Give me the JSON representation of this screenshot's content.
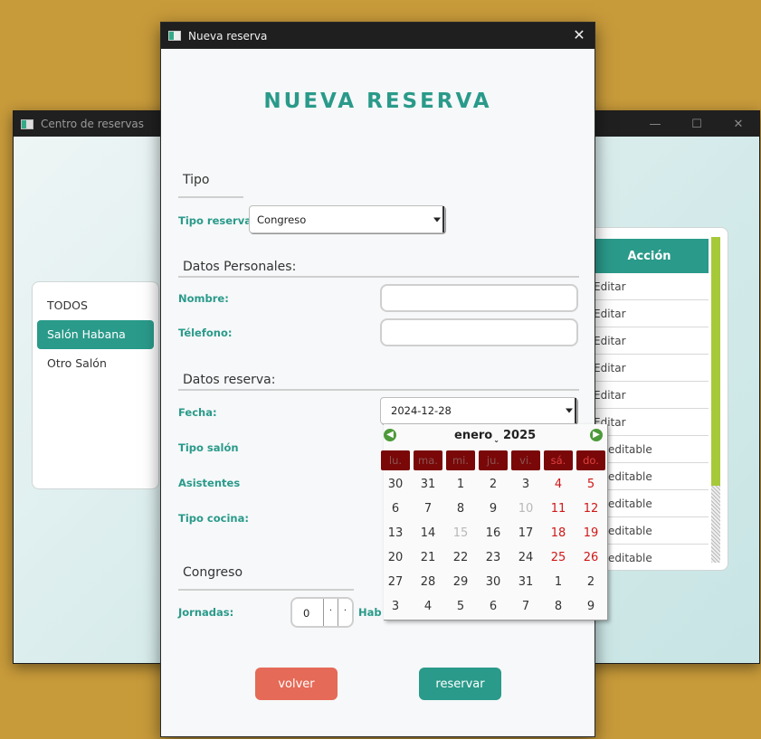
{
  "background_window": {
    "title": "Centro de reservas",
    "controls": {
      "minimize": "—",
      "maximize": "☐",
      "close": "✕"
    },
    "salon_list": [
      "TODOS",
      "Salón Habana",
      "Otro Salón"
    ],
    "selected_salon": "Salón Habana",
    "table": {
      "column_header": "Acción",
      "rows": [
        "Editar",
        "Editar",
        "Editar",
        "Editar",
        "Editar",
        "Editar",
        "editable",
        "editable",
        "editable",
        "editable",
        "editable"
      ]
    }
  },
  "dialog": {
    "title": "Nueva reserva",
    "close_glyph": "✕",
    "heading": "NUEVA RESERVA",
    "sections": {
      "tipo": "Tipo",
      "datos_personales": "Datos Personales:",
      "datos_reserva": "Datos reserva:",
      "congreso": "Congreso"
    },
    "labels": {
      "tipo_reserva": "Tipo reserva:",
      "nombre": "Nombre:",
      "telefono": "Télefono:",
      "fecha": "Fecha:",
      "tipo_salon": "Tipo salón",
      "asistentes": "Asistentes",
      "tipo_cocina": "Tipo cocina:",
      "jornadas": "Jornadas:",
      "hab": "Hab"
    },
    "values": {
      "tipo_reserva": "Congreso",
      "nombre": "",
      "telefono": "",
      "fecha": "2024-12-28",
      "jornadas": "0",
      "spinner_dec": "·",
      "spinner_inc": "·"
    },
    "buttons": {
      "volver": "volver",
      "reservar": "reservar"
    }
  },
  "calendar": {
    "month": "enero",
    "year": "2025",
    "prev_glyph": "◀",
    "next_glyph": "▶",
    "weekdays": [
      "lu.",
      "ma.",
      "mi.",
      "ju.",
      "vi.",
      "sá.",
      "do."
    ],
    "weeks": [
      [
        "30",
        "31",
        "1",
        "2",
        "3",
        "4",
        "5"
      ],
      [
        "6",
        "7",
        "8",
        "9",
        "10",
        "11",
        "12"
      ],
      [
        "13",
        "14",
        "15",
        "16",
        "17",
        "18",
        "19"
      ],
      [
        "20",
        "21",
        "22",
        "23",
        "24",
        "25",
        "26"
      ],
      [
        "27",
        "28",
        "29",
        "30",
        "31",
        "1",
        "2"
      ],
      [
        "3",
        "4",
        "5",
        "6",
        "7",
        "8",
        "9"
      ]
    ],
    "dimmed_days": [
      "15",
      "10"
    ],
    "colors": {
      "weekend": "#d01818",
      "header_bg": "#7a0808",
      "accent": "#2a9a8a"
    }
  }
}
